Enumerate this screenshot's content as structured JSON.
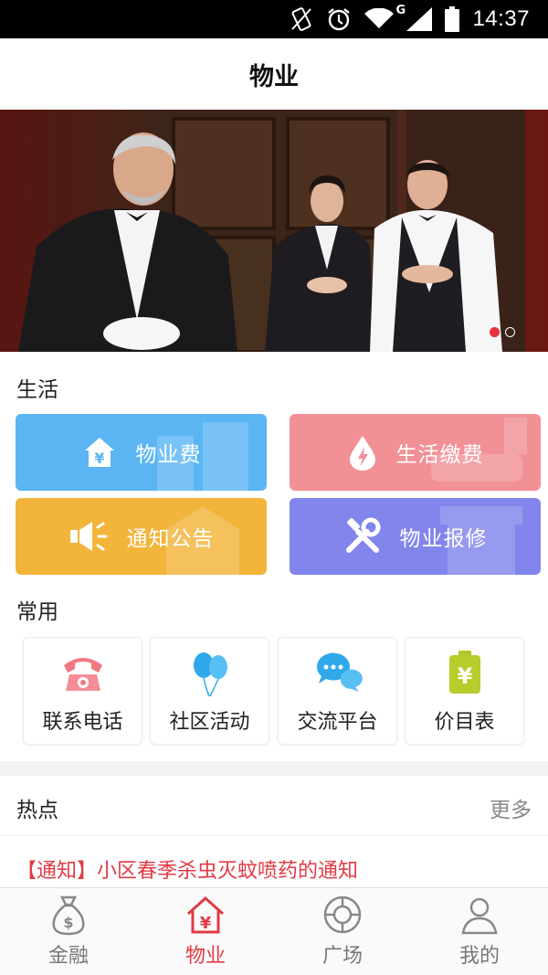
{
  "status_bar": {
    "time": "14:37",
    "network_label": "G"
  },
  "header": {
    "title": "物业"
  },
  "banner": {
    "slide_count": 2,
    "active_index": 0
  },
  "sections": {
    "life_title": "生活",
    "common_title": "常用"
  },
  "services": [
    {
      "label": "物业费",
      "icon": "house-yen-icon",
      "color": "#5bb5f3"
    },
    {
      "label": "生活缴费",
      "icon": "water-drop-bolt-icon",
      "color": "#f19196"
    },
    {
      "label": "通知公告",
      "icon": "megaphone-icon",
      "color": "#f2b43a"
    },
    {
      "label": "物业报修",
      "icon": "tools-icon",
      "color": "#8185ec"
    }
  ],
  "common": [
    {
      "label": "联系电话",
      "icon": "telephone-icon"
    },
    {
      "label": "社区活动",
      "icon": "balloons-icon"
    },
    {
      "label": "交流平台",
      "icon": "chat-bubbles-icon"
    },
    {
      "label": "价目表",
      "icon": "price-list-icon"
    }
  ],
  "hot": {
    "title": "热点",
    "more": "更多",
    "news": [
      {
        "tag": "【通知】",
        "text": "小区春季杀虫灭蚊喷药的通知"
      }
    ]
  },
  "tabs": [
    {
      "label": "金融",
      "icon": "money-bag-icon",
      "active": false
    },
    {
      "label": "物业",
      "icon": "house-yen-icon",
      "active": true
    },
    {
      "label": "广场",
      "icon": "lifebuoy-icon",
      "active": false
    },
    {
      "label": "我的",
      "icon": "user-icon",
      "active": false
    }
  ],
  "colors": {
    "accent": "#e23a45",
    "status_bg": "#000000"
  }
}
